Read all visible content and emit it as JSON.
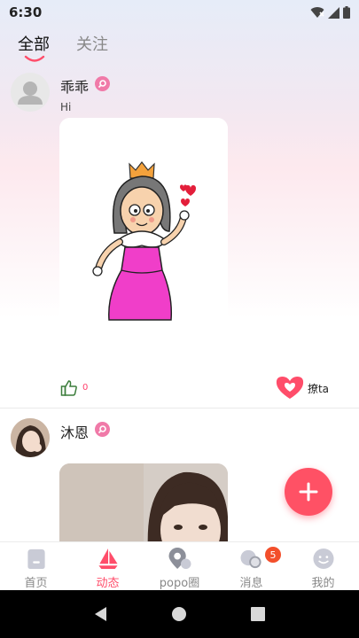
{
  "status_bar": {
    "time": "6:30"
  },
  "tabs": [
    {
      "label": "全部",
      "active": true
    },
    {
      "label": "关注",
      "active": false
    }
  ],
  "posts": [
    {
      "username": "乖乖",
      "text": "Hi",
      "like_count": "0",
      "flirt_label": "撩ta"
    },
    {
      "username": "沐恩"
    }
  ],
  "bottom_nav": [
    {
      "label": "首页",
      "icon": "home-icon"
    },
    {
      "label": "动态",
      "icon": "sailboat-icon",
      "active": true
    },
    {
      "label": "popo圈",
      "icon": "location-pin-icon"
    },
    {
      "label": "消息",
      "icon": "chat-bubbles-icon",
      "badge": "5"
    },
    {
      "label": "我的",
      "icon": "smiley-face-icon"
    }
  ],
  "colors": {
    "accent": "#ff4d6a",
    "badge": "#f07aa8",
    "fab": "#ff5165",
    "message_badge": "#f34f2b"
  }
}
